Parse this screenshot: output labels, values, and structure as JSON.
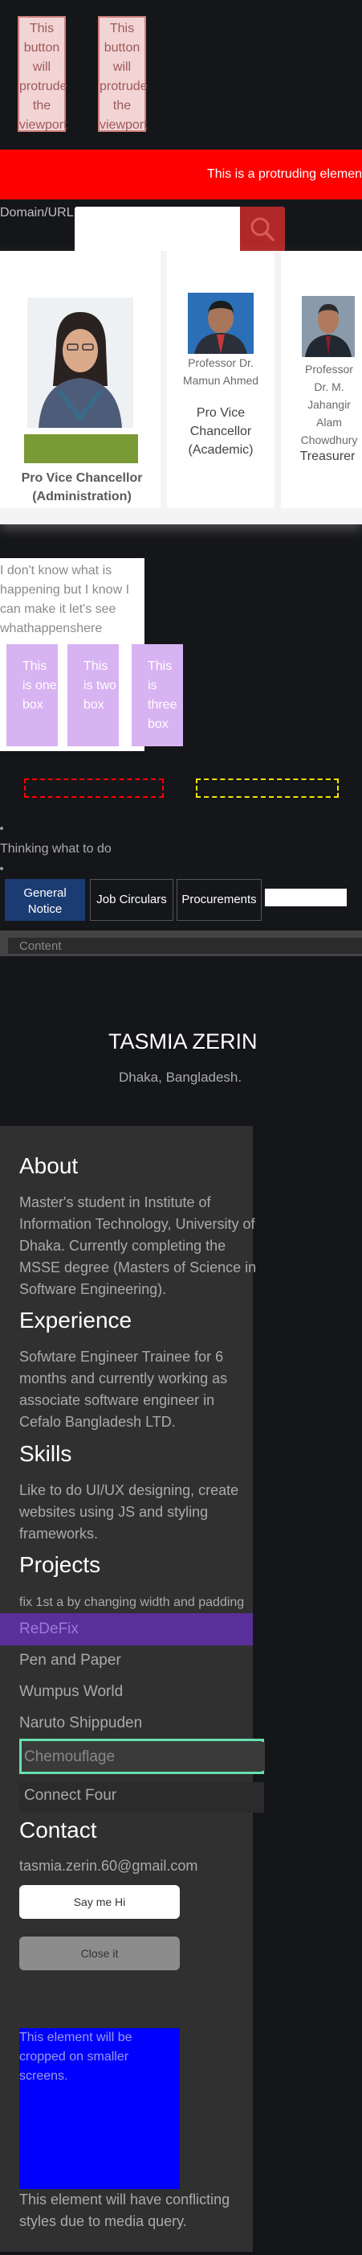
{
  "protrude_buttons": [
    "This button will protrude the viewport",
    "This button will protrude the viewport"
  ],
  "red_banner": "This is a protruding element",
  "search": {
    "label": "Domain/URL:",
    "placeholder": ""
  },
  "cards": [
    {
      "caption": "Pro Vice Chancellor (Administration)"
    },
    {
      "name": "Professor Dr. Mamun Ahmed",
      "title": "Pro Vice Chancellor (Academic)"
    },
    {
      "name": "Professor Dr. M. Jahangir Alam Chowdhury",
      "title": "Treasurer"
    }
  ],
  "blurb": "I don't know what is happening but I know I can make it let's see whathappenshere",
  "boxes": [
    "This is one box",
    "This is two box",
    "This is three box"
  ],
  "thinking": "Thinking what to do",
  "tabs": [
    "General Notice",
    "Job Circulars",
    "Procurements"
  ],
  "content_label": "Content",
  "profile": {
    "name": "TASMIA ZERIN",
    "location": "Dhaka, Bangladesh."
  },
  "about": {
    "heading": "About",
    "text": "Master's student in Institute of Information Technology, University of Dhaka. Currently completing the MSSE degree (Masters of Science in Software Engineering)."
  },
  "experience": {
    "heading": "Experience",
    "text": "Sofwtare Engineer Trainee for 6 months and currently working as associate software engineer in Cefalo Bangladesh LTD."
  },
  "skills": {
    "heading": "Skills",
    "text": "Like to do UI/UX designing, create websites using JS and styling frameworks."
  },
  "projects": {
    "heading": "Projects",
    "note": "fix 1st a by changing width and padding",
    "items": [
      "ReDeFix",
      "Pen and Paper",
      "Wumpus World",
      "Naruto Shippuden",
      "Chemouflage",
      "Connect Four"
    ]
  },
  "contact": {
    "heading": "Contact",
    "email": "tasmia.zerin.60@gmail.com",
    "say_hi": "Say me Hi",
    "close": "Close it"
  },
  "blue_box": "This element will be cropped on smaller screens.",
  "conflict_note": "This element will have conflicting styles due to media query.",
  "colors": {
    "red": "#ff0000",
    "tab_active": "#1b3c73",
    "project_highlight": "#5a2f9a",
    "chemouflage_border": "#66e0b0",
    "blue_box": "#0000ff"
  }
}
